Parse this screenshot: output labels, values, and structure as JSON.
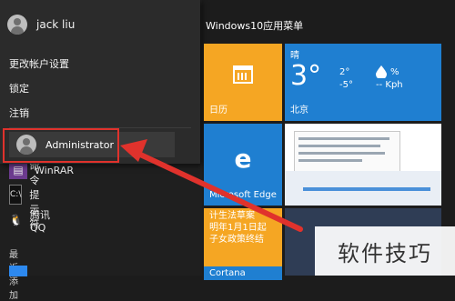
{
  "start_menu": {
    "header_title": "Windows10应用菜单",
    "user_menu": {
      "user_name": "jack liu",
      "items": [
        "更改帐户设置",
        "锁定",
        "注销"
      ],
      "switch_user": "Administrator"
    },
    "apps": [
      {
        "label": "WinRAR",
        "icon": "winrar-icon"
      },
      {
        "label": "命令提示符",
        "icon": "cmd-icon"
      },
      {
        "label": "腾讯QQ",
        "icon": "qq-icon"
      }
    ],
    "recent_label": "最近添加"
  },
  "tiles": {
    "calendar": {
      "label": "日历"
    },
    "weather": {
      "condition": "晴",
      "temp": "3°",
      "high": "2°",
      "low": "-5°",
      "humidity": "%",
      "wind": "-- Kph",
      "city": "北京"
    },
    "edge": {
      "label": "Microsoft Edge"
    },
    "news": {
      "text_lines": [
        "计生法草案",
        "明年1月1日起",
        "子女政策终结"
      ]
    },
    "cortana": {
      "label": "Cortana"
    }
  },
  "watermark": "软件技巧",
  "colors": {
    "accent_orange": "#f5a623",
    "accent_blue": "#1f7fd1",
    "highlight_red": "#e0322c",
    "menu_bg": "#2b2b2b"
  }
}
